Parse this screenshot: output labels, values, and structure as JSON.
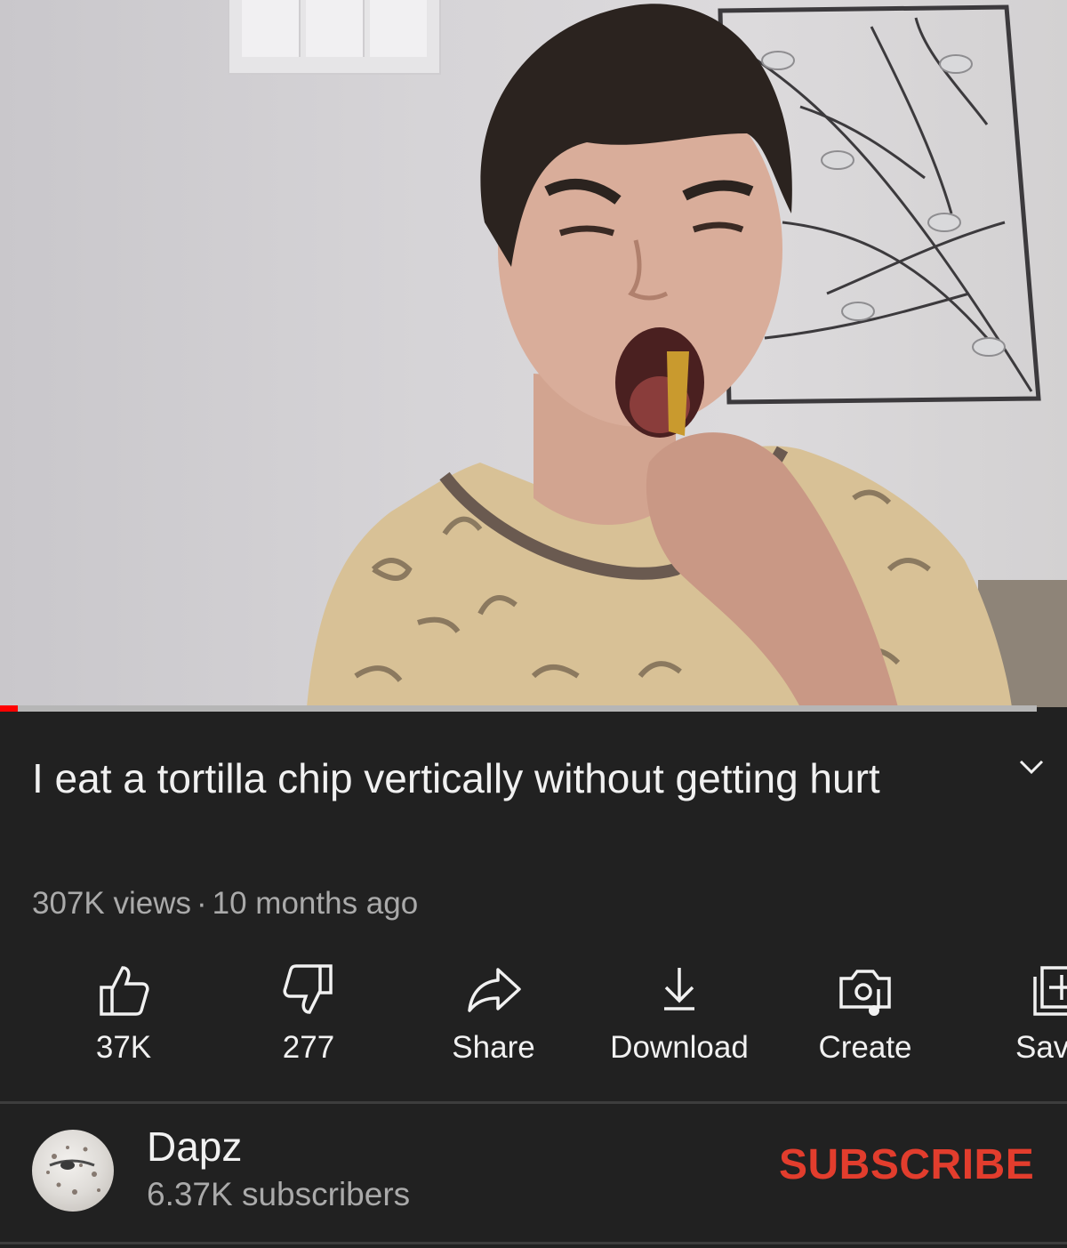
{
  "video": {
    "progress_fraction": 0.017
  },
  "title": "I eat a tortilla chip vertically without getting hurt",
  "meta": {
    "views": "307K views",
    "separator": "·",
    "age": "10 months ago"
  },
  "actions": [
    {
      "label": "37K",
      "icon": "thumbs-up-icon"
    },
    {
      "label": "277",
      "icon": "thumbs-down-icon"
    },
    {
      "label": "Share",
      "icon": "share-icon"
    },
    {
      "label": "Download",
      "icon": "download-icon"
    },
    {
      "label": "Create",
      "icon": "create-icon"
    },
    {
      "label": "Sav",
      "icon": "save-to-playlist-icon"
    }
  ],
  "channel": {
    "name": "Dapz",
    "subscribers": "6.37K subscribers",
    "subscribe_label": "SUBSCRIBE"
  },
  "colors": {
    "background": "#212121",
    "accent": "#e23d2d",
    "progress": "#ff0000",
    "secondary_text": "#aaaaaa"
  }
}
